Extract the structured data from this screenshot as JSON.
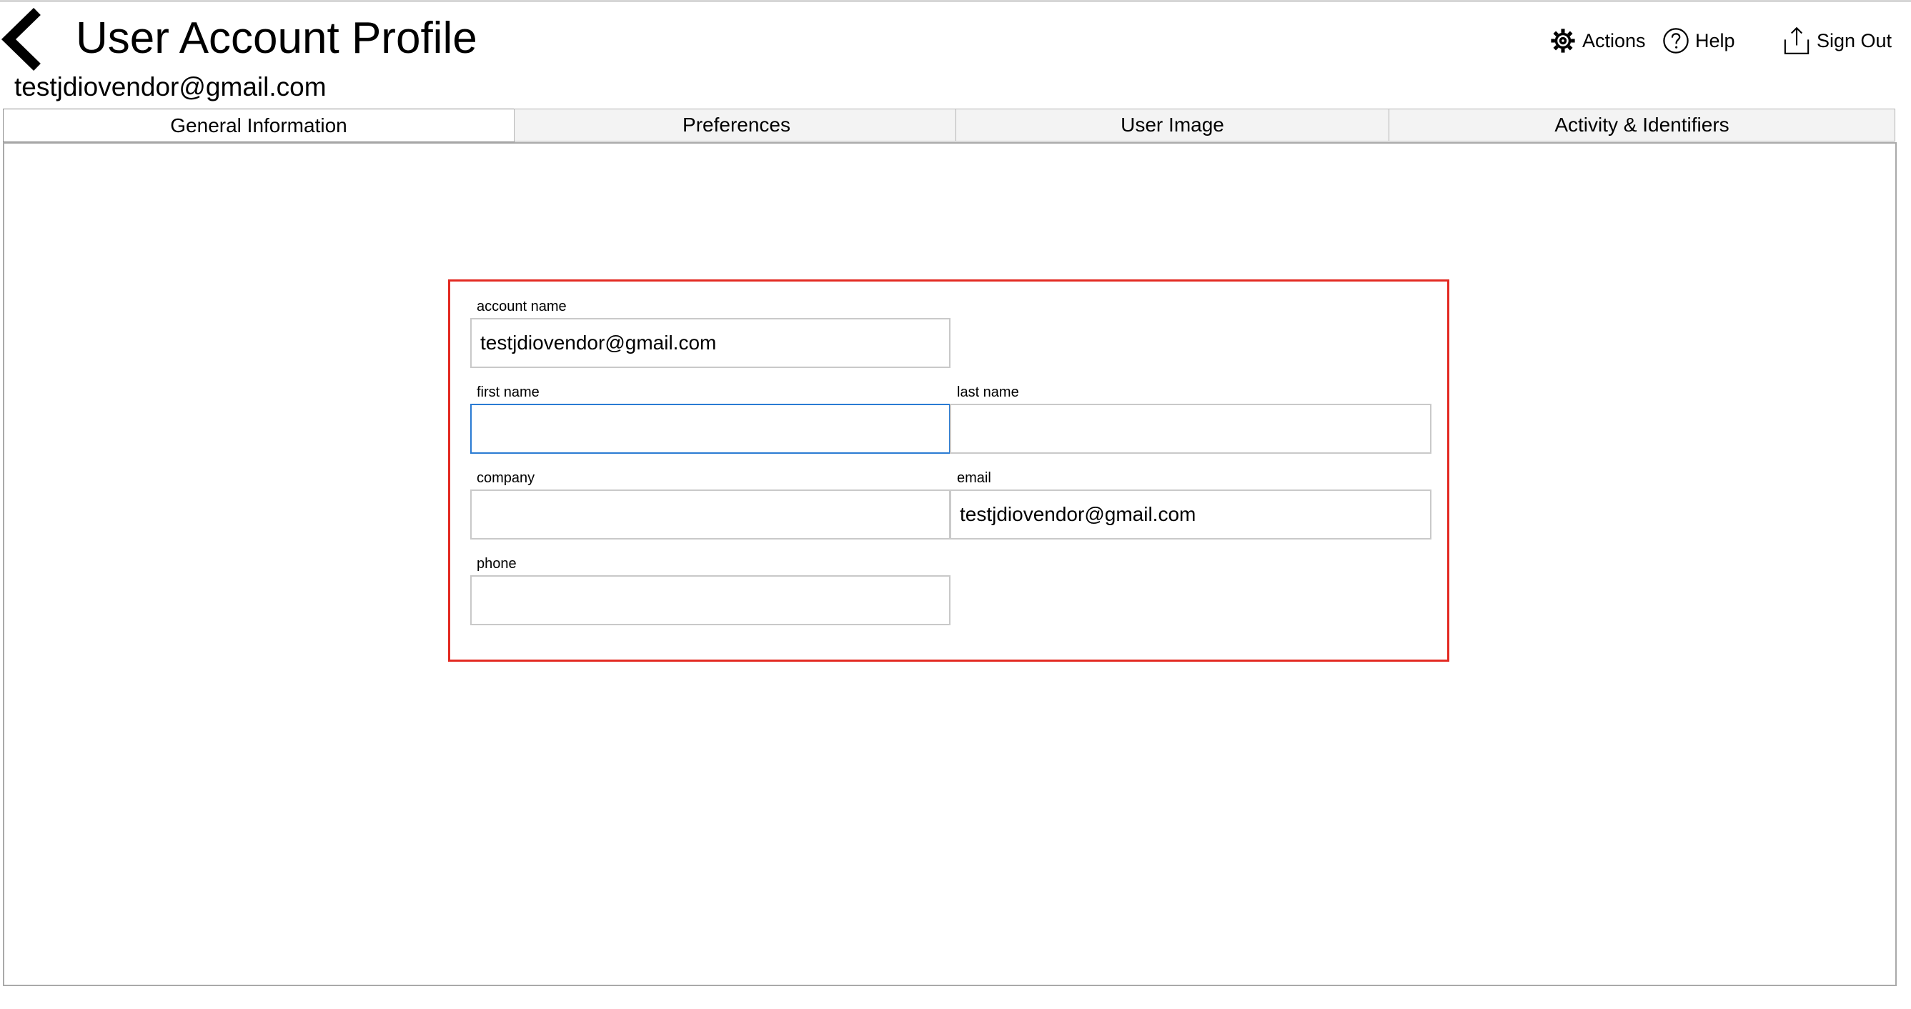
{
  "header": {
    "title": "User Account Profile",
    "subtitle": "testjdiovendor@gmail.com",
    "actions": [
      {
        "label": "Actions",
        "icon": "gear-icon"
      },
      {
        "label": "Help",
        "icon": "help-circle-icon"
      },
      {
        "label": "Sign Out",
        "icon": "upload-arrow-icon"
      }
    ]
  },
  "tabs": [
    {
      "label": "General Information",
      "active": true
    },
    {
      "label": "Preferences",
      "active": false
    },
    {
      "label": "User Image",
      "active": false
    },
    {
      "label": "Activity & Identifiers",
      "active": false
    }
  ],
  "form": {
    "account_name": {
      "label": "account name",
      "value": "testjdiovendor@gmail.com"
    },
    "first_name": {
      "label": "first name",
      "value": ""
    },
    "last_name": {
      "label": "last name",
      "value": ""
    },
    "company": {
      "label": "company",
      "value": ""
    },
    "email": {
      "label": "email",
      "value": "testjdiovendor@gmail.com"
    },
    "phone": {
      "label": "phone",
      "value": ""
    }
  },
  "colors": {
    "highlight_border": "#e32a22",
    "focus_border": "#2a7bd3",
    "tab_background": "#f3f3f3"
  }
}
